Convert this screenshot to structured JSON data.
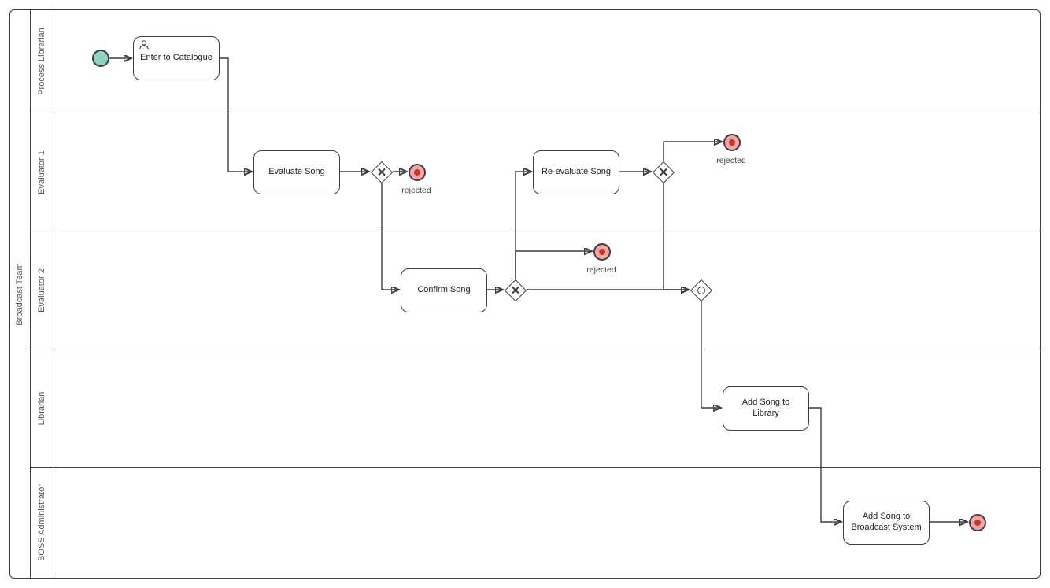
{
  "pool": {
    "name": "Broadcast Team"
  },
  "lanes": {
    "process_librarian": "Process Librarian",
    "evaluator_1": "Evaluator 1",
    "evaluator_2": "Evaluator 2",
    "librarian": "Librarian",
    "boss_admin": "BOSS Administrator"
  },
  "tasks": {
    "enter_catalogue": "Enter to Catalogue",
    "evaluate_song": "Evaluate Song",
    "reevaluate_song": "Re-evaluate Song",
    "confirm_song": "Confirm Song",
    "add_library": "Add Song to Library",
    "add_broadcast": "Add Song to Broadcast System"
  },
  "events": {
    "rejected_1": "rejected",
    "rejected_2": "rejected",
    "rejected_3": "rejected"
  },
  "icons": {
    "user_icon_name": "user-task-icon"
  }
}
